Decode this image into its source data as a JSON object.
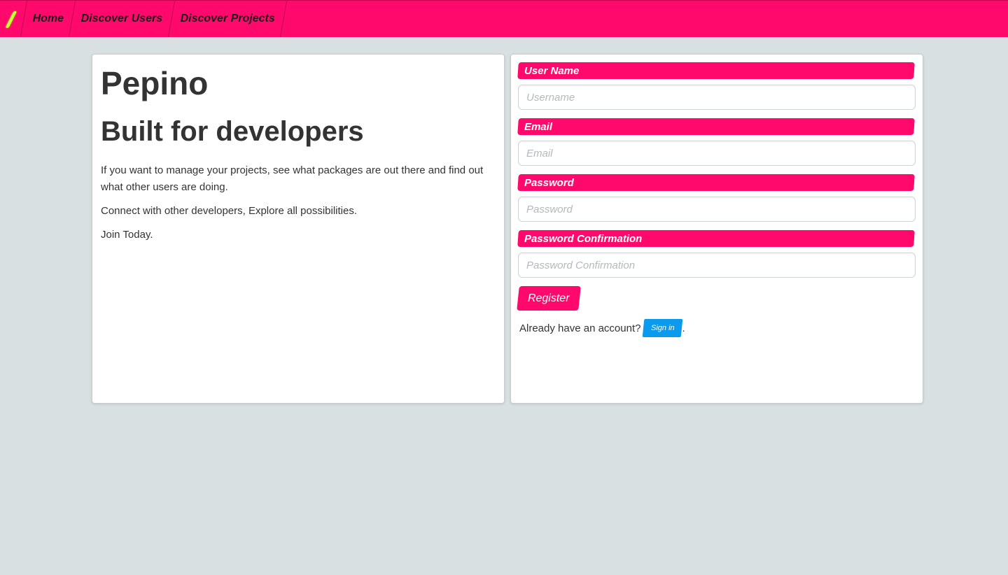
{
  "nav": {
    "brand_icon": "logo-slash-icon",
    "items": [
      "Home",
      "Discover Users",
      "Discover Projects"
    ]
  },
  "hero": {
    "title": "Pepino",
    "subtitle": "Built for developers",
    "paragraphs": [
      "If you want to manage your projects, see what packages are out there and find out what other users are doing.",
      "Connect with other developers, Explore all possibilities.",
      "Join Today."
    ]
  },
  "form": {
    "fields": [
      {
        "label": "User Name",
        "placeholder": "Username",
        "value": ""
      },
      {
        "label": "Email",
        "placeholder": "Email",
        "value": ""
      },
      {
        "label": "Password",
        "placeholder": "Password",
        "value": ""
      },
      {
        "label": "Password Confirmation",
        "placeholder": "Password Confirmation",
        "value": ""
      }
    ],
    "submit_label": "Register",
    "signin_prompt": "Already have an account?",
    "signin_label": "Sign in",
    "signin_suffix": "."
  },
  "colors": {
    "accent": "#ff0a6c",
    "brand_mark": "#c6ff3a",
    "link_button": "#0a9bef",
    "background": "#d9e0e2"
  }
}
